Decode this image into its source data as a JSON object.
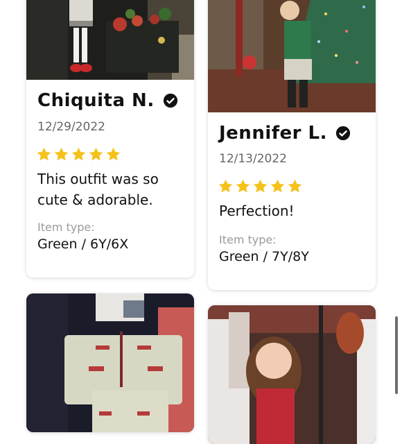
{
  "reviews": [
    {
      "name": "Chiquita N.",
      "date": "12/29/2022",
      "rating": 5,
      "text": "This outfit was so cute & adorable.",
      "item_type_label": "Item type:",
      "item_type": "Green / 6Y/6X"
    },
    {
      "name": "Jennifer L.",
      "date": "12/13/2022",
      "rating": 5,
      "text": "Perfection!",
      "item_type_label": "Item type:",
      "item_type": "Green / 7Y/8Y"
    }
  ],
  "colors": {
    "star": "#F5C21B",
    "text": "#111111",
    "muted": "#666666",
    "label": "#9A9A9A"
  },
  "icons": {
    "verified": "verified-check-icon",
    "star": "star-icon"
  }
}
